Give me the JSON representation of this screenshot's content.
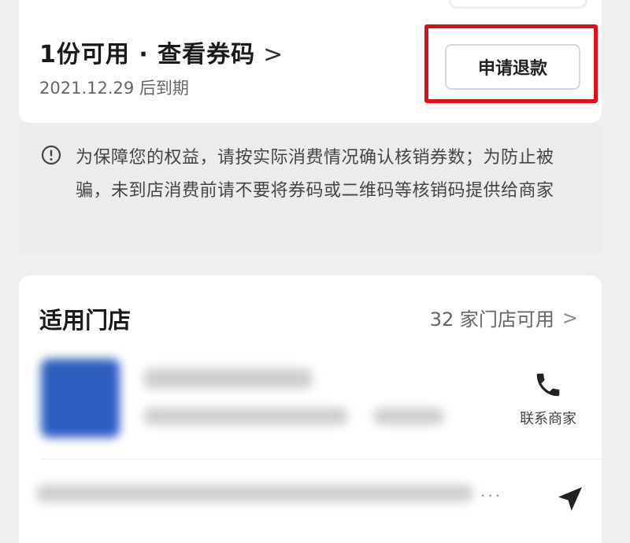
{
  "voucher": {
    "title": "1份可用 · 查看券码",
    "chevron": ">",
    "expiry": "2021.12.29 后到期",
    "refund_label": "申请退款"
  },
  "notice": {
    "icon": "info-circle-icon",
    "text": "为保障您的权益，请按实际消费情况确认核销券数；为防止被骗，未到店消费前请不要将券码或二维码等核销码提供给商家"
  },
  "stores": {
    "title": "适用门店",
    "count_label": "32 家门店可用",
    "chevron": ">",
    "contact_label": "联系商家",
    "ellipsis": "...",
    "icons": [
      "phone-icon",
      "navigation-arrow-icon"
    ]
  },
  "colors": {
    "highlight": "#d8121c",
    "thumb_blue": "#2d5dbf"
  }
}
